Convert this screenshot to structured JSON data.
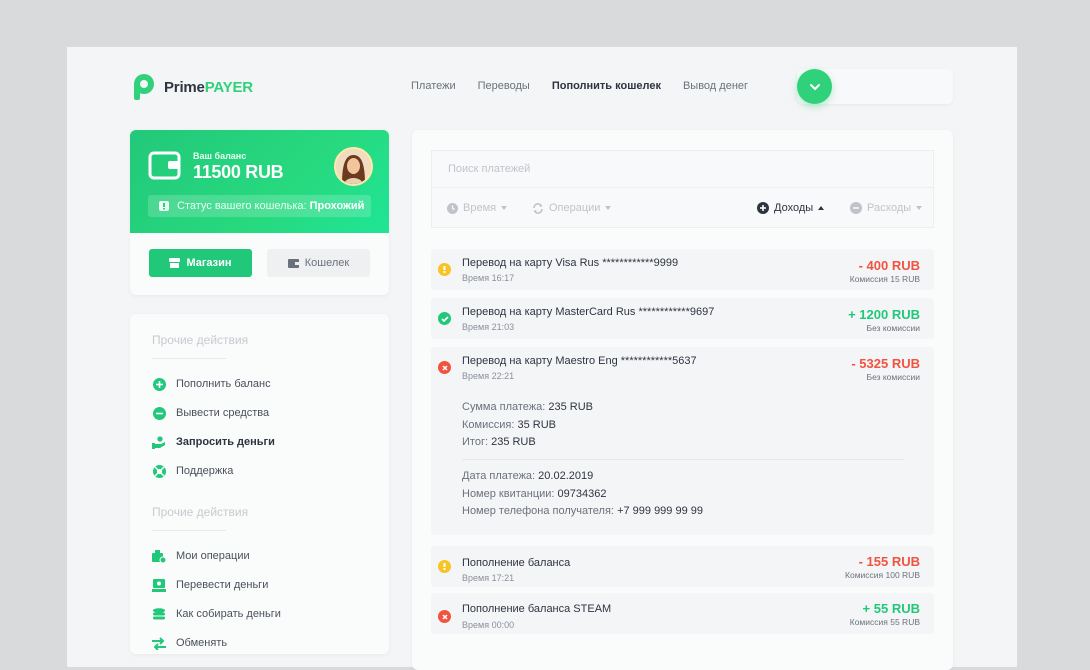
{
  "brand": {
    "name_prefix": "Prime",
    "name_accent": "PAYER",
    "accent_color": "#2fd27a"
  },
  "nav": [
    {
      "label": "Платежи",
      "active": false
    },
    {
      "label": "Переводы",
      "active": false
    },
    {
      "label": "Пополнить кошелек",
      "active": true
    },
    {
      "label": "Вывод денег",
      "active": false
    }
  ],
  "balance": {
    "label": "Ваш баланс",
    "value": "11500 RUB",
    "status_prefix": "Статус вашего кошелька:",
    "status_value": "Прохожий",
    "shop_button": "Магазин",
    "wallet_button": "Кошелек"
  },
  "sidebar": {
    "section1_title": "Прочие действия",
    "section1_items": [
      {
        "label": "Пополнить баланс",
        "icon": "plus-circle-icon"
      },
      {
        "label": "Вывести средства",
        "icon": "minus-circle-icon"
      },
      {
        "label": "Запросить деньги",
        "icon": "hand-money-icon"
      },
      {
        "label": "Поддержка",
        "icon": "lifebuoy-icon"
      }
    ],
    "section2_title": "Прочие действия",
    "section2_items": [
      {
        "label": "Мои операции",
        "icon": "operations-icon"
      },
      {
        "label": "Перевести деньги",
        "icon": "money-transfer-icon"
      },
      {
        "label": "Как собирать деньги",
        "icon": "coins-icon"
      },
      {
        "label": "Обменять",
        "icon": "exchange-icon"
      }
    ]
  },
  "search": {
    "placeholder": "Поиск платежей"
  },
  "filters": {
    "time": "Время",
    "operations": "Операции",
    "income": "Доходы",
    "expenses": "Расходы"
  },
  "transactions": [
    {
      "title": "Перевод на карту Visa Rus ************9999",
      "time": "Время 16:17",
      "amount": "- 400 RUB",
      "fee": "Комиссия 15 RUB",
      "status": "pending"
    },
    {
      "title": "Перевод на карту MasterCard Rus ************9697",
      "time": "Время 21:03",
      "amount": "+ 1200 RUB",
      "fee": "Без комиссии",
      "status": "success"
    },
    {
      "title": "Перевод на карту Maestro Eng ************5637",
      "time": "Время 22:21",
      "amount": "- 5325 RUB",
      "fee": "Без комиссии",
      "status": "failed"
    },
    {
      "title": "Пополнение баланса",
      "time": "Время 17:21",
      "amount": "- 155 RUB",
      "fee": "Комиссия 100 RUB",
      "status": "pending"
    },
    {
      "title": "Пополнение баланса STEAM",
      "time": "Время 00:00",
      "amount": "+ 55 RUB",
      "fee": "Комиссия 55 RUB",
      "status": "failed"
    }
  ],
  "details": {
    "sum_label": "Сумма платежа:",
    "sum_value": "235 RUB",
    "fee_label": "Комиссия:",
    "fee_value": "35 RUB",
    "total_label": "Итог:",
    "total_value": "235 RUB",
    "date_label": "Дата платежа:",
    "date_value": "20.02.2019",
    "receipt_label": "Номер квитанции:",
    "receipt_value": "09734362",
    "phone_label": "Номер телефона получателя:",
    "phone_value": "+7 999 999 99 99"
  },
  "colors": {
    "positive": "#22c87a",
    "negative": "#f0533f",
    "pending": "#f7c325",
    "failed": "#f0533f"
  }
}
